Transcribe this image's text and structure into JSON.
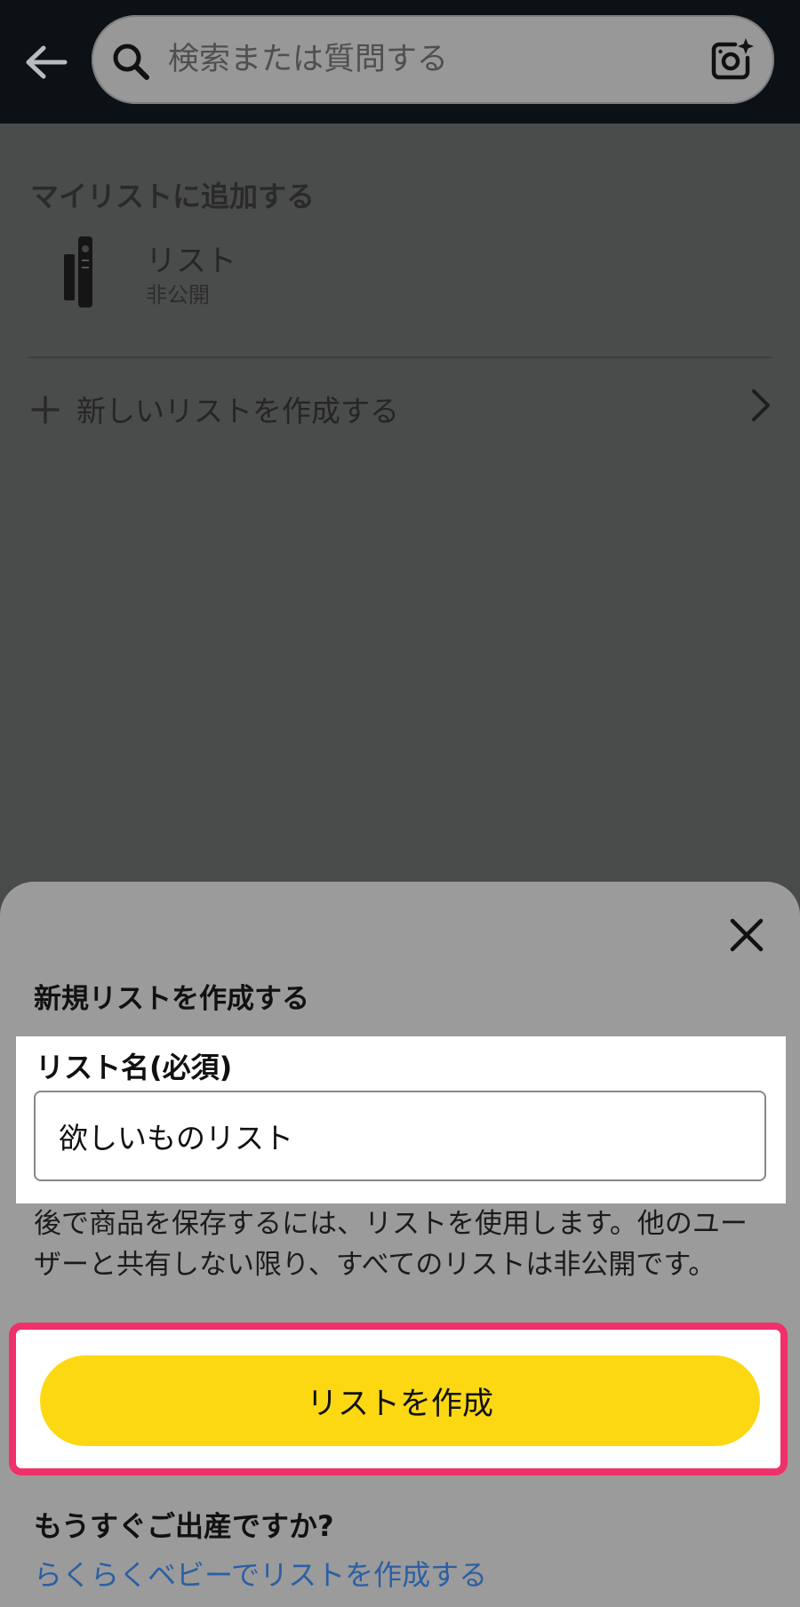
{
  "header": {
    "search_placeholder": "検索または質問する"
  },
  "background": {
    "section_title": "マイリストに追加する",
    "list": {
      "name": "リスト",
      "privacy": "非公開"
    },
    "new_list_label": "新しいリストを作成する"
  },
  "sheet": {
    "title": "新規リストを作成する",
    "field_label": "リスト名(必須)",
    "name_value": "欲しいものリスト",
    "description": "後で商品を保存するには、リストを使用します。他のユーザーと共有しない限り、すべてのリストは非公開です。",
    "create_button_label": "リストを作成",
    "baby_question": "もうすぐご出産ですか?",
    "baby_link": "らくらくベビーでリストを作成する"
  },
  "colors": {
    "header_bg": "#0c1115",
    "overlay_bg": "#4a4b4b",
    "sheet_bg": "#9b9b9b",
    "primary_button": "#fcd813",
    "highlight_border": "#f0306a",
    "link": "#2b5fa4"
  },
  "icons": {
    "back": "arrow-left-icon",
    "search": "search-icon",
    "camera": "camera-sparkle-icon",
    "plus": "plus-icon",
    "chevron": "chevron-right-icon",
    "close": "close-icon"
  }
}
